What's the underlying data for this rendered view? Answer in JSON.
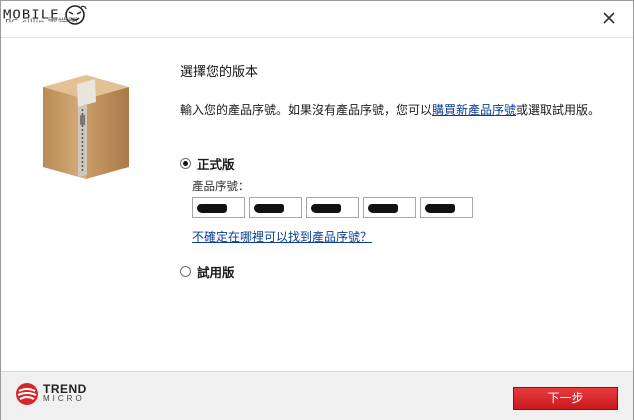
{
  "titlebar": {
    "watermark_text": "MOBILE",
    "watermark_subtext": "PC-cillin 雲端版",
    "close_glyph": "✕"
  },
  "main": {
    "heading": "選擇您的版本",
    "description_before": "輸入您的產品序號。如果沒有產品序號，您可以",
    "description_link": "購買新產品序號",
    "description_after": "或選取試用版。",
    "full_version_label": "正式版",
    "full_version_checked": true,
    "serial_label": "產品序號：",
    "serial_fields": [
      "",
      "",
      "",
      "",
      ""
    ],
    "help_link": "不確定在哪裡可以找到產品序號？",
    "trial_label": "試用版",
    "trial_checked": false
  },
  "footer": {
    "brand_line1": "TREND",
    "brand_line2": "MICRO",
    "next_button": "下一步"
  },
  "colors": {
    "accent_red": "#d7262a",
    "link_blue": "#0b3d91",
    "footer_bg": "#f0f0f0"
  }
}
